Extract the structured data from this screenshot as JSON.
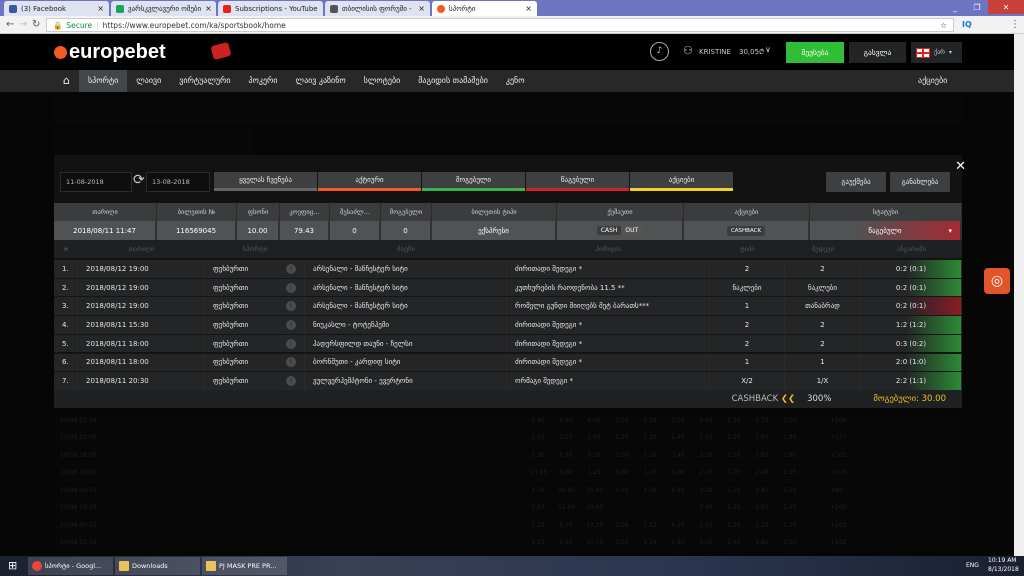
{
  "browser": {
    "tabs": [
      {
        "label": "(3) Facebook",
        "color": "#3b5998"
      },
      {
        "label": "ვარსკვლავური ომები",
        "color": "#1aa260"
      },
      {
        "label": "Subscriptions - YouTube",
        "color": "#e62117"
      },
      {
        "label": "თბილისის ფორუმი -",
        "color": "#555"
      },
      {
        "label": "სპორტი",
        "color": "#f15a22"
      }
    ],
    "secure": "Secure",
    "url": "https://www.europebet.com/ka/sportsbook/home"
  },
  "site": {
    "logo": "europebet",
    "user": "KRISTINE",
    "balance": "30,05₾",
    "deposit": "შევსება",
    "logout": "გასვლა",
    "lang": "ქარ",
    "promo_right": "აქციები",
    "nav": [
      "სპორტი",
      "ლაივი",
      "ვირტუალური",
      "პოკერი",
      "ლაივ კაზინო",
      "სლოტები",
      "მაგიდის თამაშები",
      "კენო"
    ]
  },
  "modal": {
    "date_from": "11-08-2018",
    "date_to": "13-08-2018",
    "filters": [
      {
        "label": "ყველას ჩვენება",
        "color": "#666"
      },
      {
        "label": "აქტიური",
        "color": "#f15a22"
      },
      {
        "label": "მოგებული",
        "color": "#3cb44a"
      },
      {
        "label": "წაგებული",
        "color": "#d02030"
      },
      {
        "label": "აქციები",
        "color": "#f2d21b"
      }
    ],
    "cancel": "გაუქმება",
    "refresh": "განახლება",
    "headers": [
      "თარიღი",
      "ბილეთის №",
      "ფსონი",
      "კოეფიც...",
      "შესაძლ...",
      "მოგებული",
      "ბილეთის ტიპი",
      "ქეშაუთი",
      "აქციები",
      "სტატუსი"
    ],
    "summary": {
      "date": "2018/08/11 11:47",
      "ticket": "116569045",
      "stake": "10.00",
      "odds": "79.43",
      "possible": "0",
      "won": "0",
      "type": "ექსპრესი",
      "cash": "CASH",
      "out": "OUT",
      "cashback_badge": "CASHBACK",
      "status": "წაგებული"
    },
    "detail_headers": [
      "#",
      "თარიღი",
      "სპორტი",
      "მატჩი",
      "პოზიცია",
      "ტიპი",
      "შედეგი",
      "ანგარიში"
    ],
    "rows": [
      {
        "n": "1.",
        "date": "2018/08/12 19:00",
        "sport": "ფეხბურთი",
        "match": "არსენალი - მანჩესტერ სიტი",
        "position": "ძირითადი შედეგი *",
        "type": "2",
        "result": "2",
        "score": "0:2 (0:1)",
        "won": true
      },
      {
        "n": "2.",
        "date": "2018/08/12 19:00",
        "sport": "ფეხბურთი",
        "match": "არსენალი - მანჩესტერ სიტი",
        "position": "კუთხურების რაოდენობა 11.5 **",
        "type": "ნაკლები",
        "result": "ნაკლები",
        "score": "0:2 (0:1)",
        "won": true
      },
      {
        "n": "3.",
        "date": "2018/08/12 19:00",
        "sport": "ფეხბურთი",
        "match": "არსენალი - მანჩესტერ სიტი",
        "position": "რომელი გუნდი მიიღებს მეტ ბარათს***",
        "type": "1",
        "result": "თანაბრად",
        "score": "0:2 (0:1)",
        "won": false
      },
      {
        "n": "4.",
        "date": "2018/08/11 15:30",
        "sport": "ფეხბურთი",
        "match": "ნიუკასლი - ტოტენჰემი",
        "position": "ძირითადი შედეგი *",
        "type": "2",
        "result": "2",
        "score": "1:2 (1:2)",
        "won": true
      },
      {
        "n": "5.",
        "date": "2018/08/11 18:00",
        "sport": "ფეხბურთი",
        "match": "ჰადერსფილდ თაუნი - ჩელსი",
        "position": "ძირითადი შედეგი *",
        "type": "2",
        "result": "2",
        "score": "0:3 (0:2)",
        "won": true
      },
      {
        "n": "6.",
        "date": "2018/08/11 18:00",
        "sport": "ფეხბურთი",
        "match": "ბორნმუთი - კარდიფ სიტი",
        "position": "ძირითადი შედეგი *",
        "type": "1",
        "result": "1",
        "score": "2:0 (1:0)",
        "won": true
      },
      {
        "n": "7.",
        "date": "2018/08/11 20:30",
        "sport": "ფეხბურთი",
        "match": "ვულვერჰემპტონი - ევერტონი",
        "position": "ორმაგი შედეგი *",
        "type": "X/2",
        "result": "1/X",
        "score": "2:2 (1:1)",
        "won": true
      }
    ],
    "footer": {
      "cashback": "CASHBACK",
      "percent": "300%",
      "won": "მოგებული: 30.00"
    }
  },
  "background_rows": [
    {
      "date": "14/08 22:30",
      "odds": [
        "1.40",
        "4.90",
        "8.00",
        "1.09",
        "1.19",
        "3.04",
        "2.50",
        "1.55",
        "1.75",
        "2.00"
      ],
      "more": "+106"
    },
    {
      "date": "15/08 23:00",
      "odds": [
        "2.55",
        "3.15",
        "2.95",
        "1.35",
        "1.30",
        "1.45",
        "1.65",
        "2.10",
        "1.85",
        "1.85"
      ],
      "more": "+137"
    },
    {
      "date": "18/08 18:00",
      "odds": [
        "1.30",
        "5.75",
        "9.50",
        "1.09",
        "1.16",
        "3.45",
        "2.50",
        "1.55",
        "1.95",
        "1.85"
      ],
      "more": "+102"
    },
    {
      "date": "18/08 20:00",
      "odds": [
        "13.25",
        "6.00",
        "1.25",
        "3.80",
        "1.15",
        "1.06",
        "2.15",
        "1.70",
        "2.45",
        "1.55"
      ],
      "more": "+100"
    },
    {
      "date": "19/08 00:15",
      "odds": [
        "1.10",
        "10.00",
        "25.00",
        "1.02",
        "1.06",
        "6.25",
        "3.20",
        "1.35",
        "2.45",
        "1.55"
      ],
      "more": "+99"
    },
    {
      "date": "19/08 16:30",
      "odds": [
        "1.07",
        "12.00",
        "39.00",
        "",
        "",
        "",
        "3.40",
        "1.30",
        "2.85",
        "1.45"
      ],
      "more": "+100"
    },
    {
      "date": "20/08 00:15",
      "odds": [
        "1.22",
        "6.75",
        "13.25",
        "1.06",
        "1.12",
        "4.10",
        "2.55",
        "1.50",
        "2.15",
        "1.70"
      ],
      "more": "+102"
    },
    {
      "date": "24/08 22:30",
      "odds": [
        "1.25",
        "6.50",
        "10.75",
        "1.07",
        "1.14",
        "3.80",
        "3.00",
        "1.40",
        "1.80",
        "2.00"
      ],
      "more": "+102"
    }
  ],
  "taskbar": {
    "items": [
      "სპორტი - Googl...",
      "Downloads",
      "PJ MASK PRE PR..."
    ],
    "lang": "ENG",
    "time": "10:19 AM",
    "date": "8/13/2018"
  }
}
